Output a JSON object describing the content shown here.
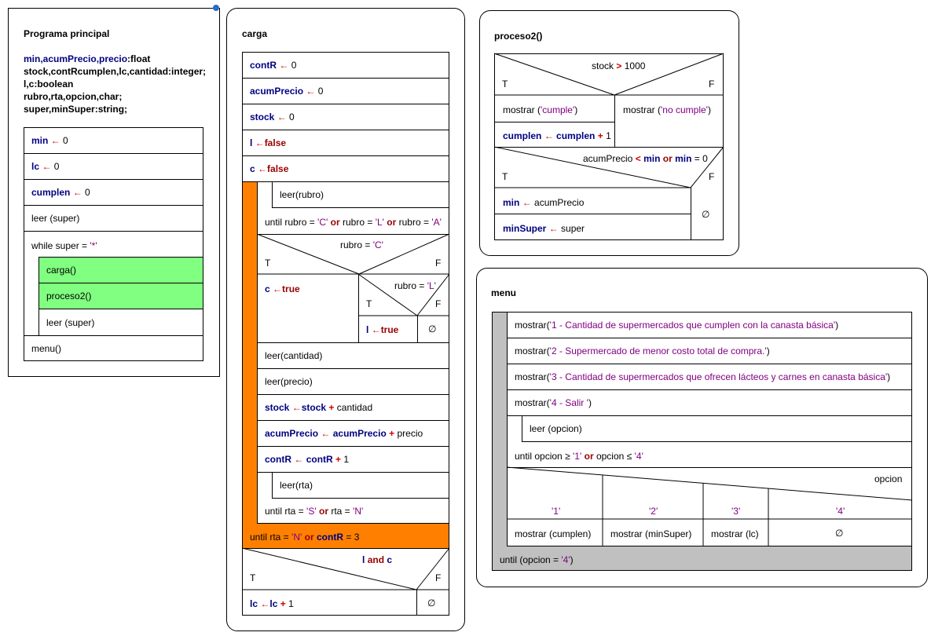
{
  "main": {
    "title": "Programa principal",
    "decls": [
      {
        "vars": "min,acumPrecio,precio",
        "type": ":float"
      },
      {
        "vars": "stock,contRcumplen,lc,cantidad",
        "type": ":integer;"
      },
      {
        "vars": "l,c",
        "type": ":boolean"
      },
      {
        "vars": "rubro,rta,opcion,char",
        "type": ";"
      },
      {
        "vars": "super,minSuper",
        "type": ":string;"
      }
    ],
    "s1_var": "min",
    "s1_val": "0",
    "s2_var": "lc",
    "s2_val": "0",
    "s3_var": "cumplen",
    "s3_val": "0",
    "read": "leer (super)",
    "while_kw": "while super =",
    "while_lit": "'*'",
    "call1": "carga()",
    "call2": "proceso2()",
    "read2": "leer (super)",
    "menu_call": "menu()"
  },
  "carga": {
    "title": "carga",
    "a1_var": "contR",
    "a1_val": "0",
    "a2_var": "acumPrecio",
    "a2_val": "0",
    "a3_var": "stock",
    "a3_val": "0",
    "a4_var": "l",
    "a4_val": "false",
    "a5_var": "c",
    "a5_val": "false",
    "read_rubro": "leer(rubro)",
    "until1": {
      "p1": "until rubro =",
      "l1": "'C'",
      "o1": "or",
      "p2": "rubro =",
      "l2": "'L'",
      "o2": "or",
      "p3": "rubro =",
      "l3": "'A'"
    },
    "if1": {
      "p": "rubro =",
      "l": "'C'",
      "t": "T",
      "f": "F"
    },
    "c_true_var": "c",
    "c_true_val": "true",
    "if2": {
      "p": "rubro =",
      "l": "'L'",
      "t": "T",
      "f": "F"
    },
    "l_true_var": "l",
    "l_true_val": "true",
    "empty": "∅",
    "read_cant": "leer(cantidad)",
    "read_precio": "leer(precio)",
    "stock_a": "stock",
    "stock_b": "stock",
    "stock_plus": "+",
    "stock_c": "cantidad",
    "acum_a": "acumPrecio",
    "acum_b": "acumPrecio",
    "acum_plus": "+",
    "acum_c": "precio",
    "cont_a": "contR",
    "cont_b": "contR",
    "cont_plus": "+",
    "cont_c": "1",
    "read_rta": "leer(rta)",
    "until2": {
      "p1": "until rta =",
      "l1": "'S'",
      "o1": "or",
      "p2": "rta =",
      "l2": "'N'"
    },
    "until3": {
      "p1": "until rta =",
      "l1": "'N'",
      "o1": "or",
      "v": "contR",
      "eq": "=",
      "n": "3"
    },
    "if3": {
      "a": "l",
      "and": "and",
      "b": "c",
      "t": "T",
      "f": "F"
    },
    "lc_a": "lc",
    "lc_b": "lc",
    "lc_plus": "+",
    "lc_c": "1",
    "empty2": "∅"
  },
  "proceso2": {
    "title": "proceso2()",
    "if1": {
      "v": "stock",
      "op": ">",
      "n": "1000",
      "t": "T",
      "f": "F"
    },
    "m1": "mostrar (",
    "m1s": "'cumple'",
    "m1e": ")",
    "m2": "mostrar (",
    "m2s": "'no cumple'",
    "m2e": ")",
    "cum_a": "cumplen",
    "cum_b": "cumplen",
    "cum_plus": "+",
    "cum_c": "1",
    "if2": {
      "v": "acumPrecio",
      "lt": "<",
      "a": "min",
      "or": "or",
      "b": "min",
      "eq": "=",
      "n": "0",
      "t": "T",
      "f": "F"
    },
    "min_a": "min",
    "min_b": "acumPrecio",
    "ms_a": "minSuper",
    "ms_b": "super",
    "empty": "∅"
  },
  "menu": {
    "title": "menu",
    "m1": "mostrar(",
    "m1s": "'1 - Cantidad de supermercados que cumplen con la canasta básica'",
    "m1e": ")",
    "m2": "mostrar(",
    "m2s": "'2 - Supermercado de menor costo total de compra.'",
    "m2e": ")",
    "m3": "mostrar(",
    "m3s": "'3 - Cantidad de supermercados que ofrecen lácteos y carnes en canasta básica'",
    "m3e": ")",
    "m4": "mostrar(",
    "m4s": "'4 - Salir '",
    "m4e": ")",
    "read": "leer (opcion)",
    "until": {
      "p1": "until opcion",
      "ge": "≥",
      "l1": "'1'",
      "o": "or",
      "p2": "opcion",
      "le": "≤",
      "l2": "'4'"
    },
    "case_var": "opcion",
    "cases": [
      "'1'",
      "'2'",
      "'3'",
      "'4'"
    ],
    "actions": [
      "mostrar (cumplen)",
      "mostrar (minSuper)",
      "mostrar (lc)",
      "∅"
    ],
    "until_outer": {
      "p": "until (opcion =",
      "l": "'4'",
      "e": ")"
    }
  },
  "colors": {
    "variable": "#000080",
    "keyword": "#990000",
    "operator": "#cc0000",
    "string": "#800080",
    "loop_green": "#80ff80",
    "loop_orange": "#ff8000",
    "loop_gray": "#c0c0c0"
  }
}
